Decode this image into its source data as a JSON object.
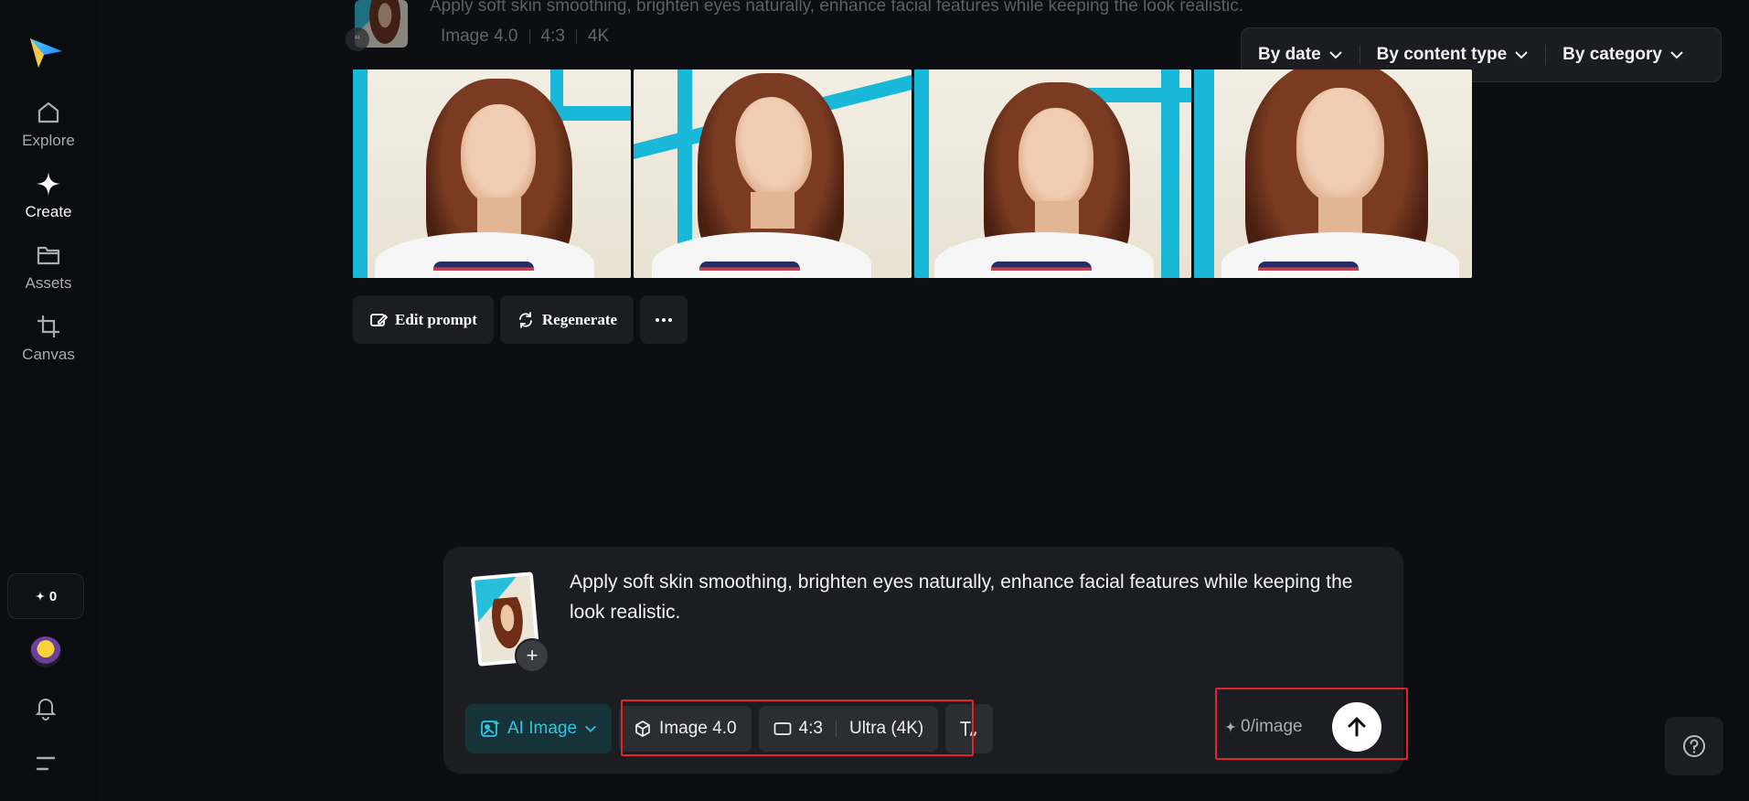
{
  "sidebar": {
    "items": [
      {
        "label": "Explore",
        "icon": "home-icon"
      },
      {
        "label": "Create",
        "icon": "sparkle-icon"
      },
      {
        "label": "Assets",
        "icon": "folder-icon"
      },
      {
        "label": "Canvas",
        "icon": "crop-icon"
      }
    ],
    "credits": "0"
  },
  "history": {
    "prompt": "Apply soft skin smoothing, brighten eyes naturally, enhance facial features while keeping the look realistic.",
    "model": "Image 4.0",
    "ratio": "4:3",
    "resolution": "4K"
  },
  "filters": {
    "date": "By date",
    "content_type": "By content type",
    "category": "By category"
  },
  "actions": {
    "edit_prompt": "Edit prompt",
    "regenerate": "Regenerate"
  },
  "composer": {
    "prompt": "Apply soft skin smoothing, brighten eyes naturally, enhance facial features while keeping the look realistic.",
    "mode": "AI Image",
    "model": "Image 4.0",
    "ratio": "4:3",
    "quality": "Ultra (4K)",
    "cost": "0/image"
  },
  "colors": {
    "accent": "#2ec7de",
    "highlight": "#e0242a",
    "background": "#0d0e11",
    "panel": "#1c1d22"
  }
}
